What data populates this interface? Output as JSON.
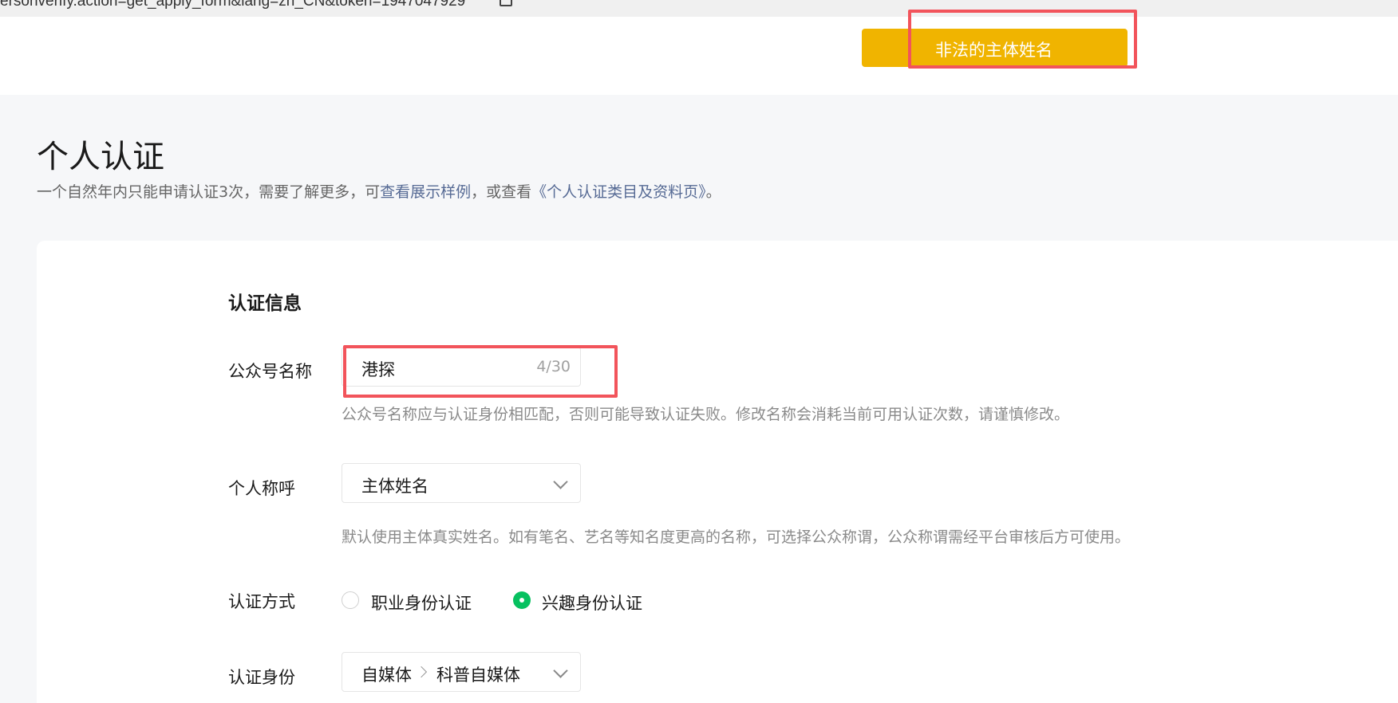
{
  "browser": {
    "url_text": "ersonverify.action=get_apply_form&lang=zh_CN&token=1947047929"
  },
  "toast": {
    "message": "非法的主体姓名",
    "color": "#f0b400"
  },
  "page": {
    "title": "个人认证",
    "subtitle_prefix": "一个自然年内只能申请认证3次，需要了解更多，可",
    "subtitle_link1": "查看展示样例",
    "subtitle_middle": "，或查看",
    "subtitle_link2": "《个人认证类目及资料页》",
    "subtitle_suffix": "。"
  },
  "form": {
    "section_title": "认证信息",
    "account_name": {
      "label": "公众号名称",
      "value": "港探",
      "counter": "4/30",
      "hint": "公众号名称应与认证身份相匹配，否则可能导致认证失败。修改名称会消耗当前可用认证次数，请谨慎修改。"
    },
    "personal_title": {
      "label": "个人称呼",
      "value": "主体姓名",
      "hint": "默认使用主体真实姓名。如有笔名、艺名等知名度更高的名称，可选择公众称谓，公众称谓需经平台审核后方可使用。"
    },
    "verify_method": {
      "label": "认证方式",
      "options": [
        {
          "label": "职业身份认证",
          "selected": false
        },
        {
          "label": "兴趣身份认证",
          "selected": true
        }
      ]
    },
    "verify_identity": {
      "label": "认证身份",
      "category": "自媒体",
      "subcategory": "科普自媒体"
    }
  },
  "colors": {
    "accent_green": "#07c160",
    "highlight_red": "#f2545b",
    "link_blue": "#576b95"
  }
}
